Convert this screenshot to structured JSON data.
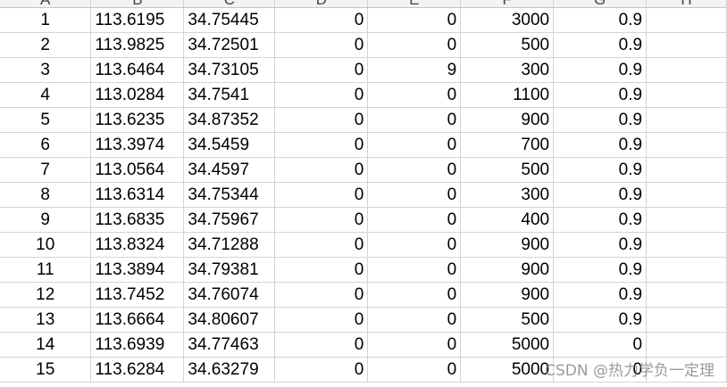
{
  "columns": [
    "A",
    "B",
    "C",
    "D",
    "E",
    "F",
    "G",
    "H"
  ],
  "rows": [
    {
      "a": "1",
      "b": "113.6195",
      "c": "34.75445",
      "d": "0",
      "e": "0",
      "f": "3000",
      "g": "0.9"
    },
    {
      "a": "2",
      "b": "113.9825",
      "c": "34.72501",
      "d": "0",
      "e": "0",
      "f": "500",
      "g": "0.9"
    },
    {
      "a": "3",
      "b": "113.6464",
      "c": "34.73105",
      "d": "0",
      "e": "9",
      "f": "300",
      "g": "0.9"
    },
    {
      "a": "4",
      "b": "113.0284",
      "c": "34.7541",
      "d": "0",
      "e": "0",
      "f": "1100",
      "g": "0.9"
    },
    {
      "a": "5",
      "b": "113.6235",
      "c": "34.87352",
      "d": "0",
      "e": "0",
      "f": "900",
      "g": "0.9"
    },
    {
      "a": "6",
      "b": "113.3974",
      "c": "34.5459",
      "d": "0",
      "e": "0",
      "f": "700",
      "g": "0.9"
    },
    {
      "a": "7",
      "b": "113.0564",
      "c": "34.4597",
      "d": "0",
      "e": "0",
      "f": "500",
      "g": "0.9"
    },
    {
      "a": "8",
      "b": "113.6314",
      "c": "34.75344",
      "d": "0",
      "e": "0",
      "f": "300",
      "g": "0.9"
    },
    {
      "a": "9",
      "b": "113.6835",
      "c": "34.75967",
      "d": "0",
      "e": "0",
      "f": "400",
      "g": "0.9"
    },
    {
      "a": "10",
      "b": "113.8324",
      "c": "34.71288",
      "d": "0",
      "e": "0",
      "f": "900",
      "g": "0.9"
    },
    {
      "a": "11",
      "b": "113.3894",
      "c": "34.79381",
      "d": "0",
      "e": "0",
      "f": "900",
      "g": "0.9"
    },
    {
      "a": "12",
      "b": "113.7452",
      "c": "34.76074",
      "d": "0",
      "e": "0",
      "f": "900",
      "g": "0.9"
    },
    {
      "a": "13",
      "b": "113.6664",
      "c": "34.80607",
      "d": "0",
      "e": "0",
      "f": "500",
      "g": "0.9"
    },
    {
      "a": "14",
      "b": "113.6939",
      "c": "34.77463",
      "d": "0",
      "e": "0",
      "f": "5000",
      "g": "0"
    },
    {
      "a": "15",
      "b": "113.6284",
      "c": "34.63279",
      "d": "0",
      "e": "0",
      "f": "5000",
      "g": "0"
    }
  ],
  "watermark": "CSDN @热力学负一定理"
}
